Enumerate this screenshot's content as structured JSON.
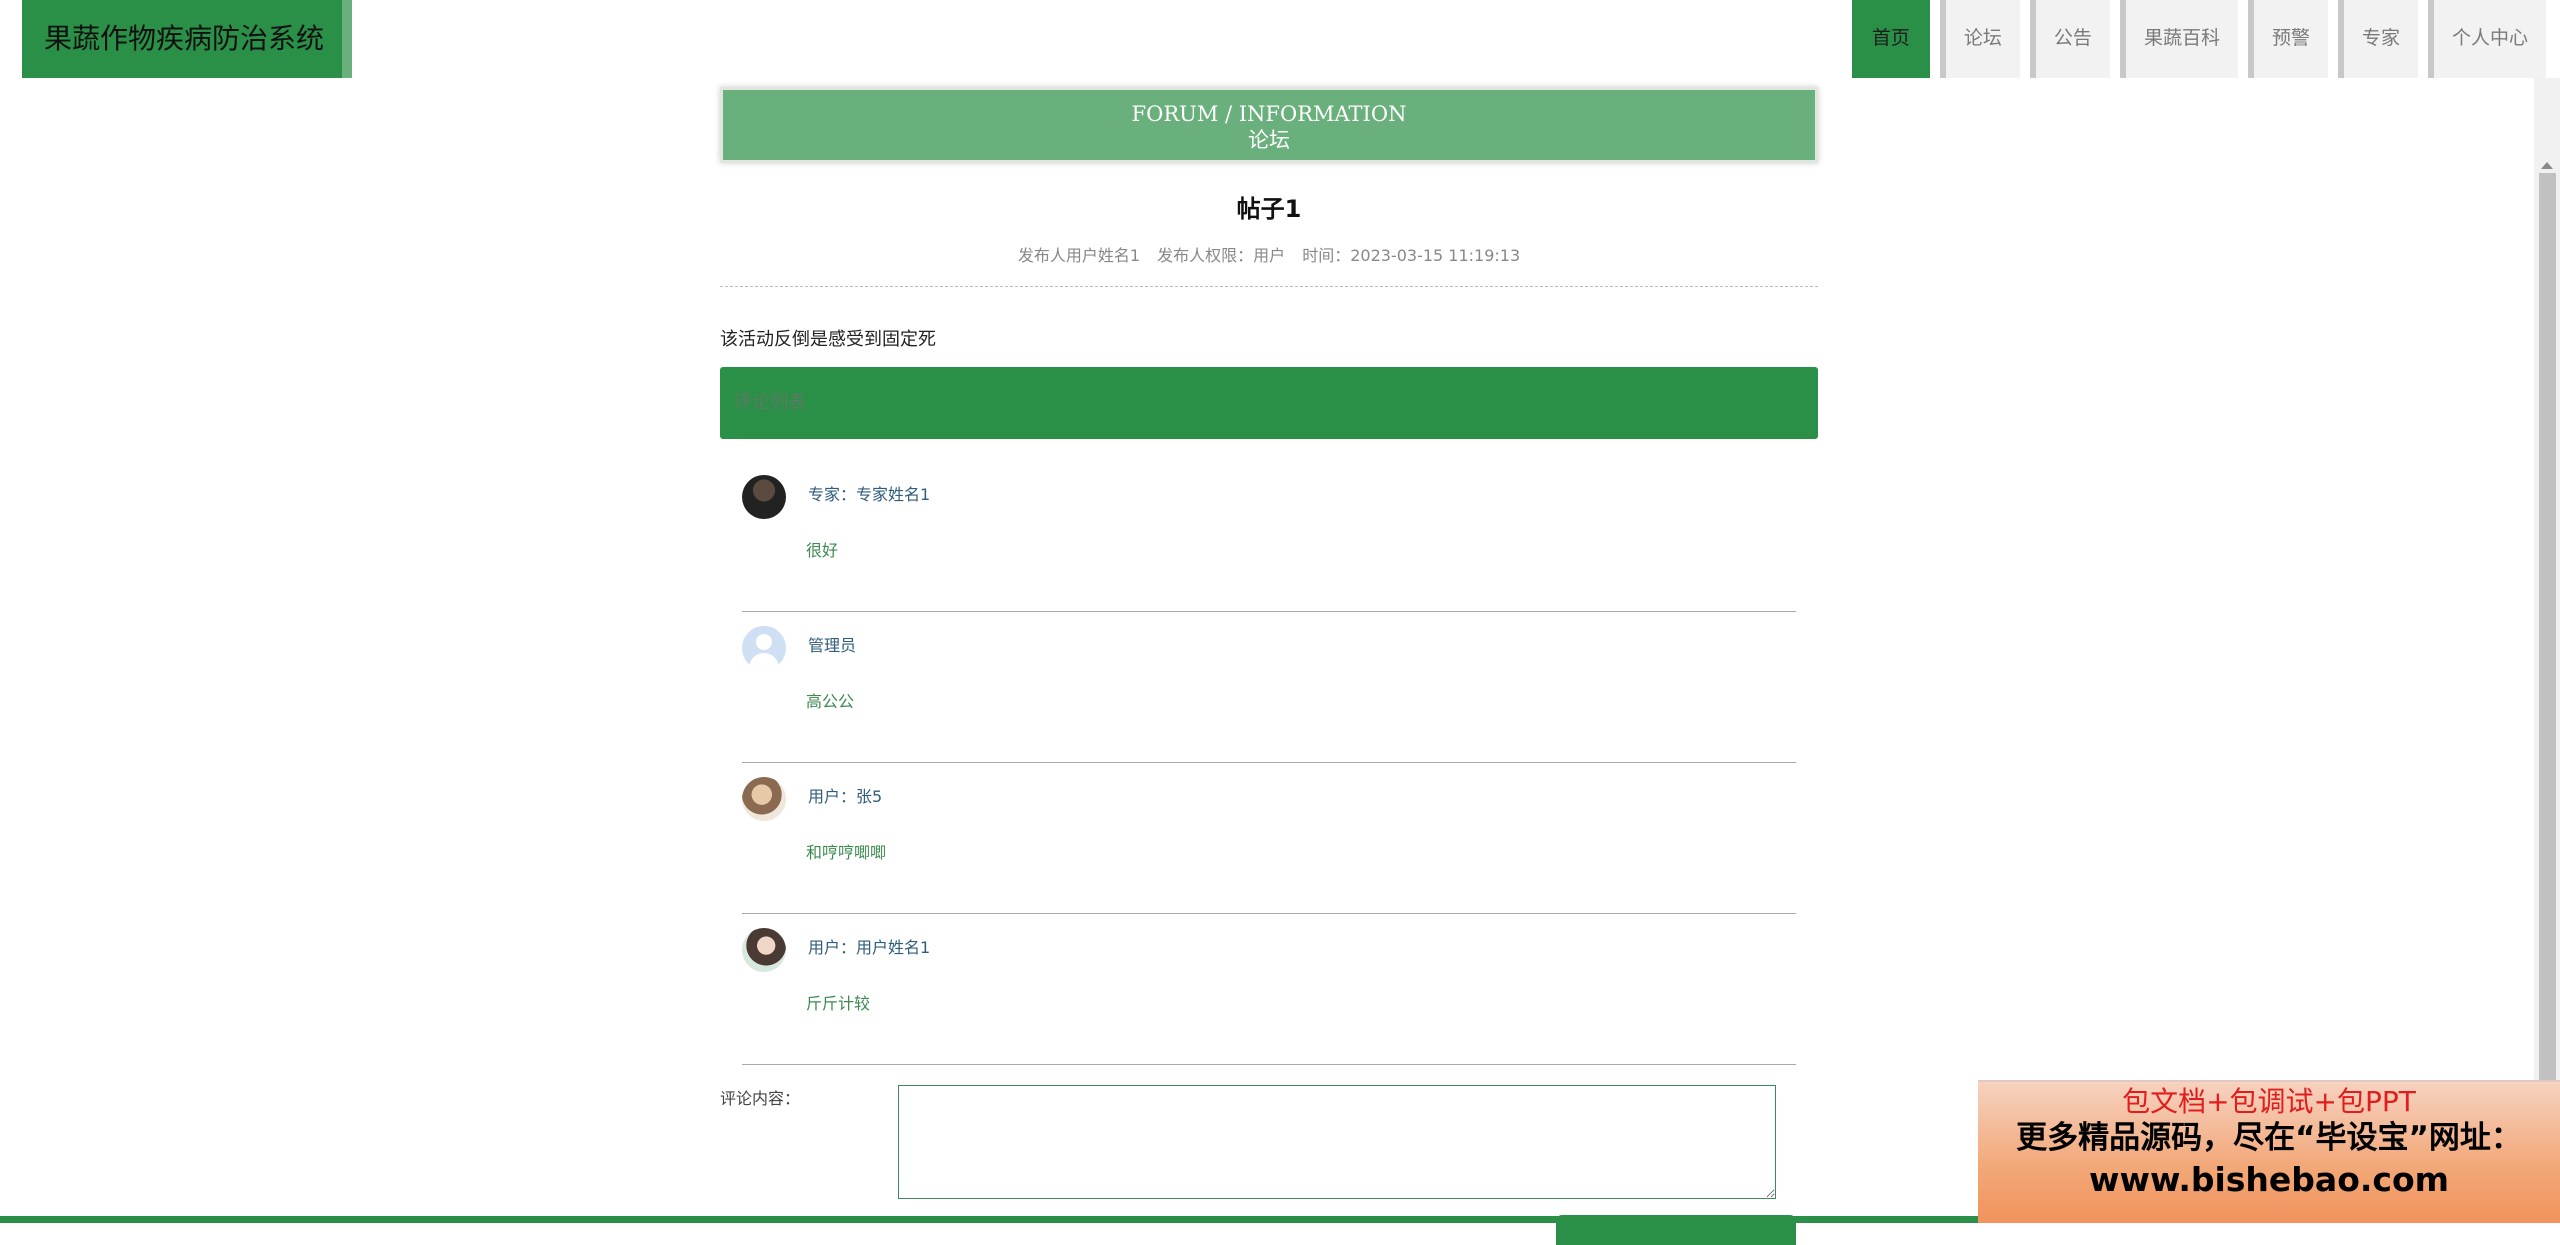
{
  "app": {
    "title": "果蔬作物疾病防治系统"
  },
  "nav": [
    {
      "label": "首页",
      "active": true
    },
    {
      "label": "论坛",
      "active": false
    },
    {
      "label": "公告",
      "active": false
    },
    {
      "label": "果蔬百科",
      "active": false
    },
    {
      "label": "预警",
      "active": false
    },
    {
      "label": "专家",
      "active": false
    },
    {
      "label": "个人中心",
      "active": false
    }
  ],
  "banner": {
    "en": "FORUM / INFORMATION",
    "cn": "论坛"
  },
  "post": {
    "title": "帖子1",
    "author": "发布人用户姓名1",
    "role": "发布人权限：用户",
    "time": "时间：2023-03-15 11:19:13",
    "content": "该活动反倒是感受到固定死"
  },
  "comments_header": "评论列表",
  "comments": [
    {
      "name": "专家：专家姓名1",
      "text": "很好",
      "avatar": "expert-avatar"
    },
    {
      "name": "管理员",
      "text": "高公公",
      "avatar": "default-user-icon"
    },
    {
      "name": "用户：张5",
      "text": "和哼哼唧唧",
      "avatar": "user-avatar"
    },
    {
      "name": "用户：用户姓名1",
      "text": "斤斤计较",
      "avatar": "user-avatar"
    }
  ],
  "form": {
    "label": "评论内容：",
    "value": "",
    "submit_label": ""
  },
  "ad": {
    "line1": "包文档+包调试+包PPT",
    "line2": "更多精品源码，尽在“毕设宝”网址：",
    "line3": "www.bishebao.com"
  },
  "colors": {
    "primary": "#2a8f47",
    "banner": "#6ab07d",
    "link": "#2f5d7c",
    "comment_text": "#3c8a50"
  }
}
